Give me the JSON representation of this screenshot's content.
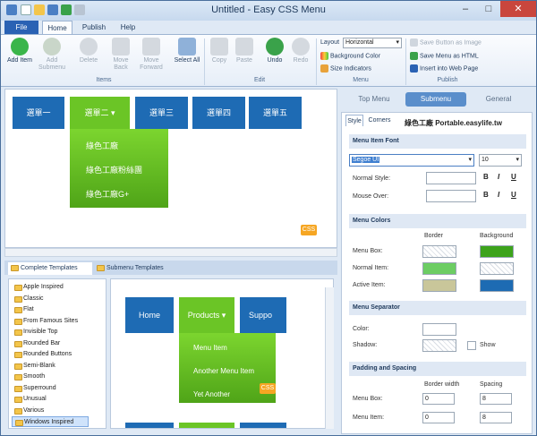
{
  "window": {
    "title": "Untitled - Easy CSS Menu",
    "minimize": "–",
    "maximize": "□",
    "close": "✕"
  },
  "tabs": {
    "file": "File",
    "home": "Home",
    "publish": "Publish",
    "help": "Help"
  },
  "ribbon": {
    "items": {
      "add_item": "Add Item",
      "add_submenu": "Add Submenu",
      "delete": "Delete",
      "move_back": "Move Back",
      "move_forward": "Move Forward",
      "select_all": "Select All",
      "group": "Items"
    },
    "edit": {
      "copy": "Copy",
      "paste": "Paste",
      "undo": "Undo",
      "redo": "Redo",
      "group": "Edit"
    },
    "menu": {
      "layout_label": "Layout",
      "layout_value": "Horizontal",
      "background_color": "Background Color",
      "size_indicators": "Size Indicators",
      "group": "Menu"
    },
    "publish": {
      "save_image": "Save Button as Image",
      "save_html": "Save Menu as HTML",
      "insert_web": "Insert into Web Page",
      "group": "Publish"
    }
  },
  "preview": {
    "menu_items": [
      "選單一",
      "選單二 ▾",
      "選單三",
      "選單四",
      "選單五"
    ],
    "dropdown_items": [
      "綠色工廠",
      "綠色工廠粉絲團",
      "綠色工廠G+"
    ],
    "css_badge": "CSS"
  },
  "bottom_tabs": {
    "complete": "Complete Templates",
    "submenu": "Submenu Templates"
  },
  "templates": [
    "Apple Inspired",
    "Classic",
    "Flat",
    "From Famous Sites",
    "Invisible Top",
    "Rounded Bar",
    "Rounded Buttons",
    "Semi-Blank",
    "Smooth",
    "Superround",
    "Unusual",
    "Various",
    "Windows Inspired"
  ],
  "template_preview": {
    "menu_items": [
      "Home",
      "Products ▾",
      "Suppo"
    ],
    "dropdown_items": [
      "Menu Item",
      "Another Menu Item",
      "Yet Another"
    ],
    "css_badge": "CSS"
  },
  "panel": {
    "tabs": {
      "top_menu": "Top Menu",
      "submenu": "Submenu",
      "general": "General"
    },
    "inner_tabs": {
      "style": "Style",
      "corners": "Corners"
    },
    "watermark": "綠色工廠 Portable.easylife.tw",
    "font": {
      "section": "Menu Item Font",
      "family": "Segoe UI",
      "size": "10",
      "normal_style": "Normal Style:",
      "mouse_over": "Mouse Over:",
      "bold": "B",
      "italic": "I",
      "underline": "U"
    },
    "colors": {
      "section": "Menu Colors",
      "border_header": "Border",
      "background_header": "Background",
      "menu_box": "Menu Box:",
      "normal_item": "Normal Item:",
      "active_item": "Active Item:",
      "menu_box_bg": "#3da31c",
      "normal_item_border": "#6ccd63",
      "active_item_border": "#c9c69a",
      "active_item_bg": "#1d6bb3"
    },
    "separator": {
      "section": "Menu Separator",
      "color": "Color:",
      "shadow": "Shadow:",
      "show": "Show"
    },
    "padding": {
      "section": "Padding and Spacing",
      "border_width": "Border width",
      "spacing": "Spacing",
      "menu_box": "Menu Box:",
      "menu_item": "Menu Item:",
      "menu_box_width": "0",
      "menu_box_spacing": "8",
      "menu_item_width": "0",
      "menu_item_spacing": "8"
    }
  }
}
